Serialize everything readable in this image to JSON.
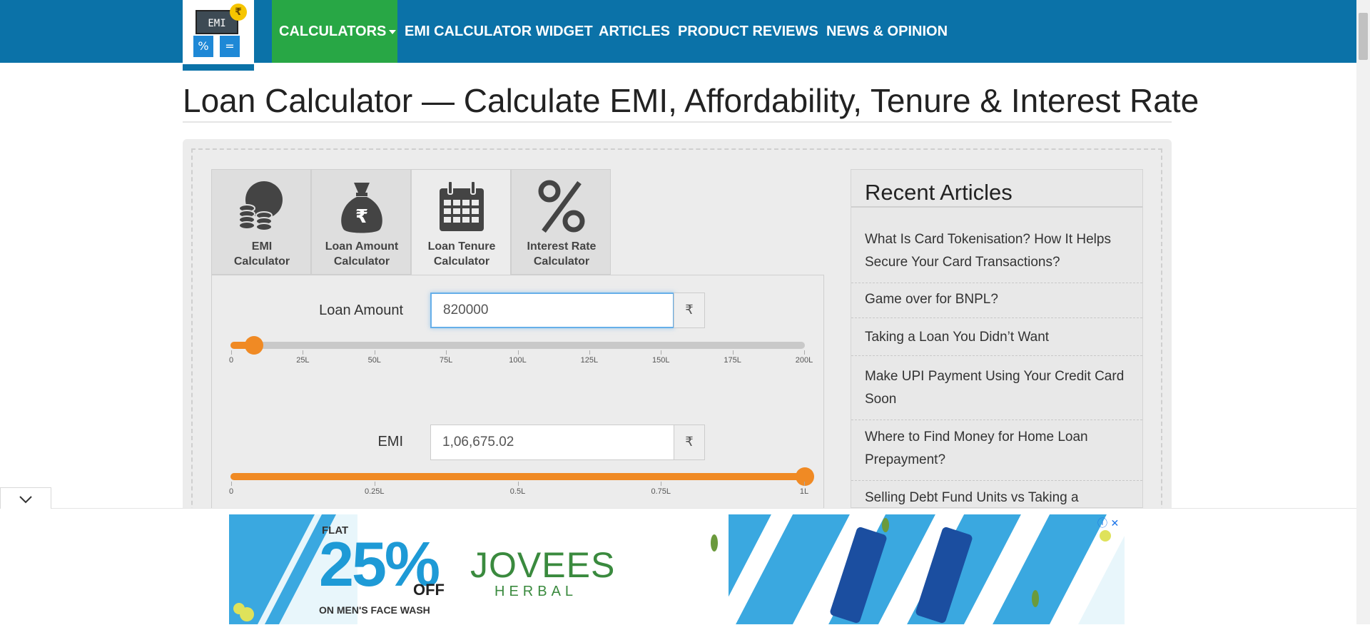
{
  "nav": {
    "logo": {
      "screen_text": "EMI",
      "rupee": "₹",
      "key_percent": "%",
      "key_equals": "="
    },
    "items": [
      {
        "label": "CALCULATORS"
      },
      {
        "label": "EMI CALCULATOR WIDGET"
      },
      {
        "label": "ARTICLES"
      },
      {
        "label": "PRODUCT REVIEWS"
      },
      {
        "label": "NEWS & OPINION"
      }
    ]
  },
  "page": {
    "title": "Loan Calculator — Calculate EMI, Affordability, Tenure & Interest Rate"
  },
  "tabs": [
    {
      "line1": "EMI",
      "line2": "Calculator",
      "icon": "coins-icon",
      "active": false
    },
    {
      "line1": "Loan Amount",
      "line2": "Calculator",
      "icon": "money-bag-icon",
      "active": false
    },
    {
      "line1": "Loan Tenure",
      "line2": "Calculator",
      "icon": "calendar-icon",
      "active": true
    },
    {
      "line1": "Interest Rate",
      "line2": "Calculator",
      "icon": "percent-icon",
      "active": false
    }
  ],
  "form": {
    "loan_amount": {
      "label": "Loan Amount",
      "value": "820000",
      "unit": "₹",
      "slider_fraction": 0.041,
      "ticks": [
        "0",
        "25L",
        "50L",
        "75L",
        "100L",
        "125L",
        "150L",
        "175L",
        "200L"
      ]
    },
    "emi": {
      "label": "EMI",
      "value": "1,06,675.02",
      "unit": "₹",
      "slider_fraction": 1.0,
      "ticks": [
        "0",
        "0.25L",
        "0.5L",
        "0.75L",
        "1L"
      ]
    }
  },
  "sidebar": {
    "title": "Recent Articles",
    "articles": [
      "What Is Card Tokenisation? How It Helps Secure Your Card Transactions?",
      "Game over for BNPL?",
      "Taking a Loan You Didn’t Want",
      "Make UPI Payment Using Your Credit Card Soon",
      "Where to Find Money for Home Loan Prepayment?",
      "Selling Debt Fund Units vs Taking a"
    ]
  },
  "ad": {
    "flat": "FLAT",
    "percent": "25%",
    "off": "OFF",
    "product_line": "ON MEN'S FACE WASH",
    "brand": "JOVEES",
    "brand_sub": "HERBAL",
    "choices_icon": "ⓘ",
    "close_icon": "✕"
  },
  "colors": {
    "nav_bg": "#0b72a8",
    "nav_active": "#28a745",
    "slider_accent": "#f08a24"
  }
}
